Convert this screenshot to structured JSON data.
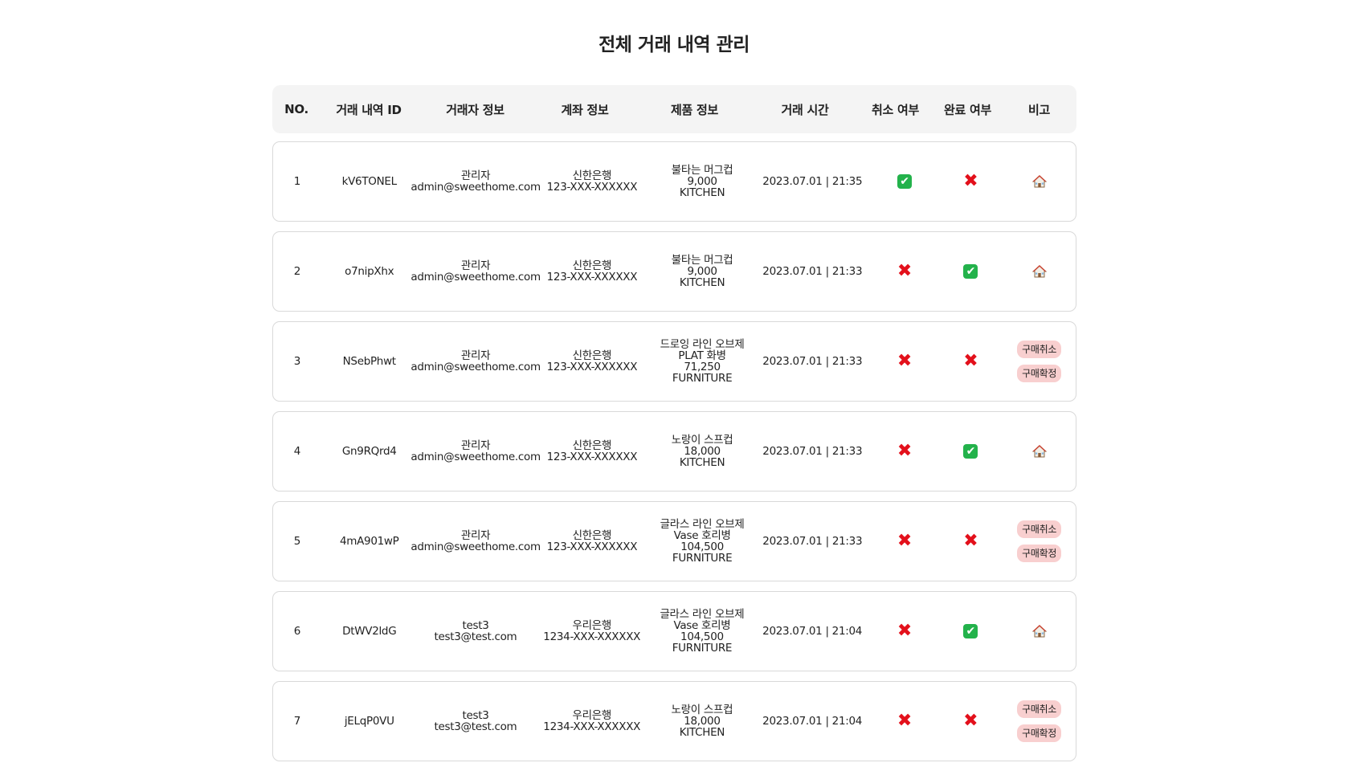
{
  "page": {
    "title": "전체 거래 내역 관리"
  },
  "columns": {
    "no": "NO.",
    "id": "거래 내역 ID",
    "trader": "거래자 정보",
    "account": "계좌 정보",
    "product": "제품 정보",
    "time": "거래 시간",
    "cancel": "취소 여부",
    "complete": "완료 여부",
    "note": "비고"
  },
  "colors": {
    "check": "#23b24b",
    "cross": "#e3101b",
    "badge_bg": "#f8cfcf",
    "header_bg": "#f4f4f4"
  },
  "rows": [
    {
      "no": "1",
      "id": "kV6TONEL",
      "trader_name": "관리자",
      "trader_email": "admin@sweethome.com",
      "bank": "신한은행",
      "account_no": "123-XXX-XXXXXX",
      "product_lines": [
        "불타는 머그컵",
        "9,000",
        "KITCHEN"
      ],
      "time": "2023.07.01 | 21:35",
      "cancelled": "check-icon",
      "completed": "cross-icon",
      "note": "house-icon"
    },
    {
      "no": "2",
      "id": "o7nipXhx",
      "trader_name": "관리자",
      "trader_email": "admin@sweethome.com",
      "bank": "신한은행",
      "account_no": "123-XXX-XXXXXX",
      "product_lines": [
        "불타는 머그컵",
        "9,000",
        "KITCHEN"
      ],
      "time": "2023.07.01 | 21:33",
      "cancelled": "cross-icon",
      "completed": "check-icon",
      "note": "house-icon"
    },
    {
      "no": "3",
      "id": "NSebPhwt",
      "trader_name": "관리자",
      "trader_email": "admin@sweethome.com",
      "bank": "신한은행",
      "account_no": "123-XXX-XXXXXX",
      "product_lines": [
        "드로잉 라인 오브제",
        "PLAT 화병",
        "71,250",
        "FURNITURE"
      ],
      "time": "2023.07.01 | 21:33",
      "cancelled": "cross-icon",
      "completed": "cross-icon",
      "note": "buttons",
      "note_buttons": [
        "구매취소",
        "구매확정"
      ]
    },
    {
      "no": "4",
      "id": "Gn9RQrd4",
      "trader_name": "관리자",
      "trader_email": "admin@sweethome.com",
      "bank": "신한은행",
      "account_no": "123-XXX-XXXXXX",
      "product_lines": [
        "노랑이 스프컵",
        "18,000",
        "KITCHEN"
      ],
      "time": "2023.07.01 | 21:33",
      "cancelled": "cross-icon",
      "completed": "check-icon",
      "note": "house-icon"
    },
    {
      "no": "5",
      "id": "4mA901wP",
      "trader_name": "관리자",
      "trader_email": "admin@sweethome.com",
      "bank": "신한은행",
      "account_no": "123-XXX-XXXXXX",
      "product_lines": [
        "글라스 라인 오브제",
        "Vase 호리병",
        "104,500",
        "FURNITURE"
      ],
      "time": "2023.07.01 | 21:33",
      "cancelled": "cross-icon",
      "completed": "cross-icon",
      "note": "buttons",
      "note_buttons": [
        "구매취소",
        "구매확정"
      ]
    },
    {
      "no": "6",
      "id": "DtWV2ldG",
      "trader_name": "test3",
      "trader_email": "test3@test.com",
      "bank": "우리은행",
      "account_no": "1234-XXX-XXXXXX",
      "product_lines": [
        "글라스 라인 오브제",
        "Vase 호리병",
        "104,500",
        "FURNITURE"
      ],
      "time": "2023.07.01 | 21:04",
      "cancelled": "cross-icon",
      "completed": "check-icon",
      "note": "house-icon"
    },
    {
      "no": "7",
      "id": "jELqP0VU",
      "trader_name": "test3",
      "trader_email": "test3@test.com",
      "bank": "우리은행",
      "account_no": "1234-XXX-XXXXXX",
      "product_lines": [
        "노랑이 스프컵",
        "18,000",
        "KITCHEN"
      ],
      "time": "2023.07.01 | 21:04",
      "cancelled": "cross-icon",
      "completed": "cross-icon",
      "note": "buttons",
      "note_buttons": [
        "구매취소",
        "구매확정"
      ]
    }
  ]
}
